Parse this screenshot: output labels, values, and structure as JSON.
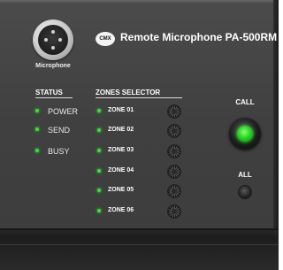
{
  "brand": {
    "logo_text": "CMX",
    "title": "Remote Microphone PA-500RM"
  },
  "microphone": {
    "label": "Microphone",
    "icon": "xlr-connector-icon"
  },
  "status": {
    "heading": "STATUS",
    "items": [
      {
        "label": "POWER",
        "led_color": "#36e236"
      },
      {
        "label": "SEND",
        "led_color": "#36e236"
      },
      {
        "label": "BUSY",
        "led_color": "#36e236"
      }
    ]
  },
  "zones": {
    "heading": "ZONES SELECTOR",
    "items": [
      {
        "label": "ZONE 01"
      },
      {
        "label": "ZONE 02"
      },
      {
        "label": "ZONE 03"
      },
      {
        "label": "ZONE 04"
      },
      {
        "label": "ZONE 05"
      },
      {
        "label": "ZONE 06"
      }
    ]
  },
  "controls": {
    "call_label": "CALL",
    "call_light_color": "#29d629",
    "all_label": "ALL"
  }
}
